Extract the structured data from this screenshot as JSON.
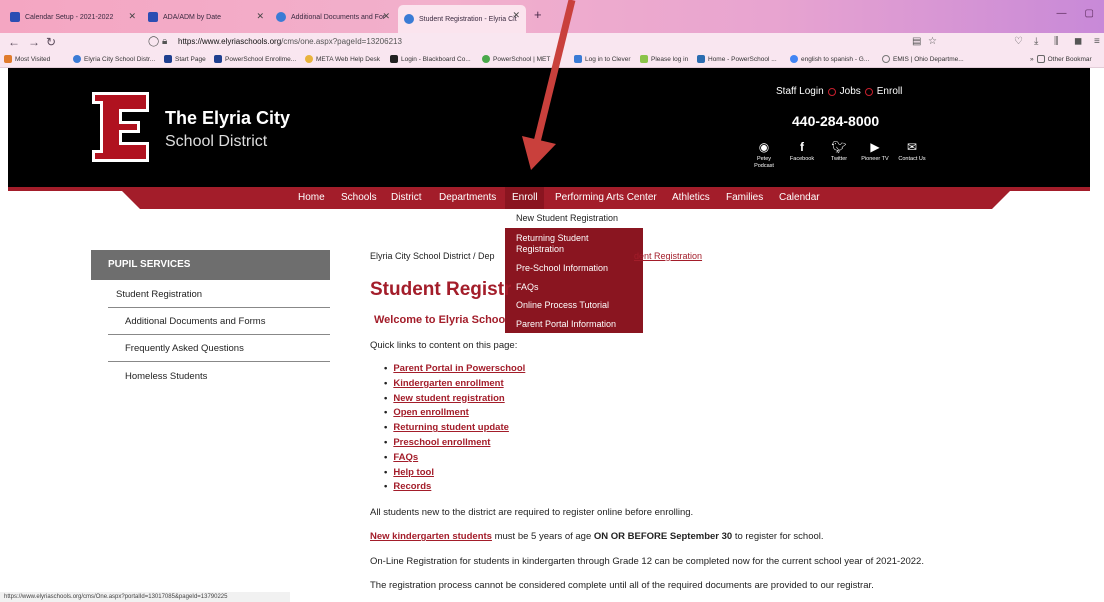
{
  "browser": {
    "tabs": [
      {
        "label": "Calendar Setup - 2021-2022",
        "color": "#2b4db3"
      },
      {
        "label": "ADA/ADM by Date",
        "color": "#2b4db3"
      },
      {
        "label": "Additional Documents and For",
        "color": "#3a7bd5"
      },
      {
        "label": "Student Registration - Elyria Cit",
        "color": "#3a7bd5"
      }
    ],
    "new_tab": "+",
    "url_host": "https://www.elyriaschools.org",
    "url_path": "/cms/one.aspx?pageId=13206213",
    "bookmarks": [
      "Most Visited",
      "Elyria City School Distr...",
      "Start Page",
      "PowerSchool Enrollme...",
      "META Web Help Desk",
      "Login - Blackboard Co...",
      "PowerSchool | MET",
      "Log in to Clever",
      "Please log in",
      "Home - PowerSchool ...",
      "english to spanish - G...",
      "EMIS | Ohio Departme...",
      "Other Bookmar"
    ],
    "status_url": "https://www.elyriaschools.org/cms/One.aspx?portalId=13017085&pageId=13790225"
  },
  "header": {
    "logo_letter": "E",
    "title": "The Elyria City",
    "subtitle": "School District",
    "top_links": [
      "Staff Login",
      "Jobs",
      "Enroll"
    ],
    "phone": "440-284-8000",
    "social": [
      {
        "label": "Petey Podcast",
        "icon": "podcast-icon"
      },
      {
        "label": "Facebook",
        "icon": "facebook-icon"
      },
      {
        "label": "Twitter",
        "icon": "twitter-icon"
      },
      {
        "label": "Pioneer TV",
        "icon": "youtube-icon"
      },
      {
        "label": "Contact Us",
        "icon": "mail-icon"
      }
    ]
  },
  "nav": {
    "items": [
      "Home",
      "Schools",
      "District",
      "Departments",
      "Enroll",
      "Performing Arts Center",
      "Athletics",
      "Families",
      "Calendar"
    ]
  },
  "enroll_menu": {
    "items": [
      "New Student Registration",
      "Returning Student Registration",
      "Pre-School Information",
      "FAQs",
      "Online Process Tutorial",
      "Parent Portal Information"
    ]
  },
  "sidebar": {
    "heading": "PUPIL SERVICES",
    "items": [
      "Student Registration",
      "Additional Documents and Forms",
      "Frequently Asked Questions",
      "Homeless Students"
    ]
  },
  "main": {
    "breadcrumb": "Elyria City School District / Dep",
    "breadcrumb_end": "dent Registration",
    "title": "Student Registr",
    "welcome": "Welcome to Elyria Schoo",
    "quick_links_intro": "Quick links to content on this page:",
    "quick_links": [
      "Parent Portal in Powerschool",
      "Kindergarten enrollment",
      "New student registration",
      "Open enrollment",
      "Returning student update",
      "Preschool enrollment",
      "FAQs",
      "Help tool",
      "Records"
    ],
    "para1": "All students new to the district are required to register online before enrolling.",
    "para2_link": "New kindergarten students",
    "para2_a": " must be 5 years of age ",
    "para2_bold": "ON OR BEFORE September 30",
    "para2_b": " to register for school.",
    "para3": "On-Line Registration for students in kindergarten through Grade 12 can be completed now for the current school year of 2021-2022.",
    "para4": "The registration process cannot be considered complete until all of the required documents are provided to our registrar."
  },
  "colors": {
    "brand_red": "#a31d2a",
    "dropdown_red": "#8a1520",
    "annotation_arrow": "#c9403c"
  }
}
